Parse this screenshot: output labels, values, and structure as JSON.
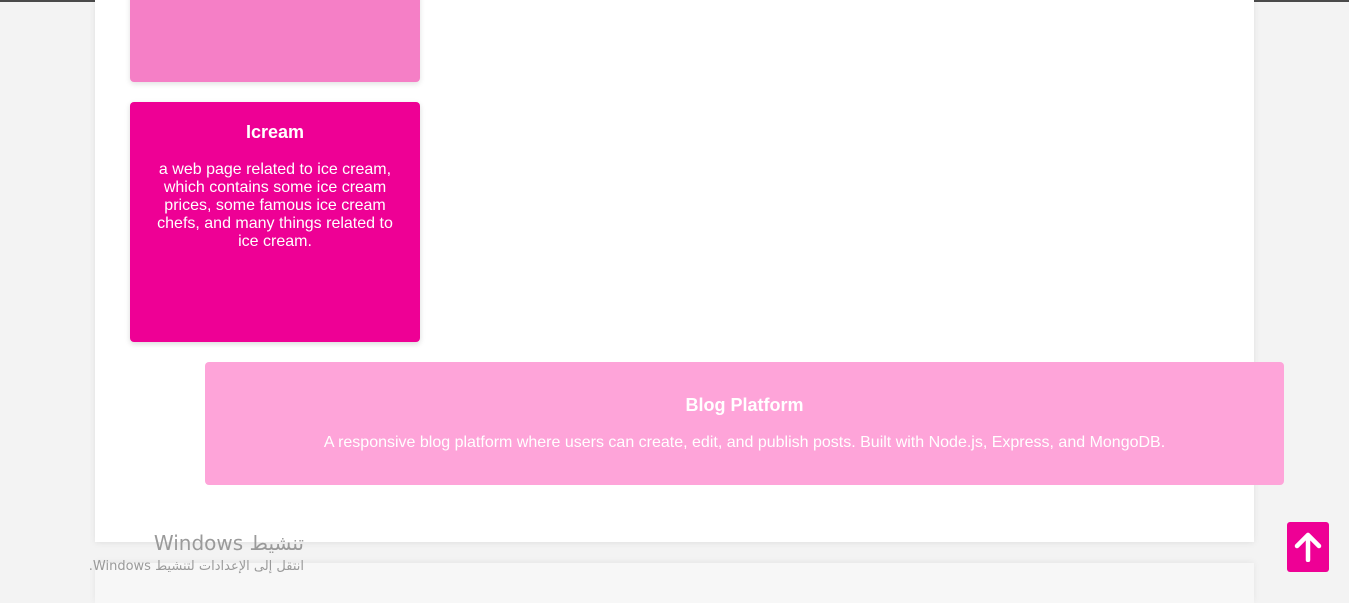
{
  "projects": [
    {
      "title": "",
      "description": "",
      "color": "#f57fc6"
    },
    {
      "title": "Icream",
      "description": "a web page related to ice cream, which contains some ice cream prices, some famous ice cream chefs, and many things related to ice cream.",
      "color": "#ee0095"
    },
    {
      "title": "Blog Platform",
      "description": "A responsive blog platform where users can create, edit, and publish posts. Built with Node.js, Express, and MongoDB.",
      "color": "#fea4d9"
    }
  ],
  "watermark": {
    "title": "تنشيط Windows",
    "subtitle": "انتقل إلى الإعدادات لتنشيط Windows."
  },
  "scroll_top": {
    "icon": "arrow-up-icon",
    "color": "#ee0095"
  },
  "colors": {
    "background": "#f3f3f3",
    "panel": "#ffffff",
    "accent": "#ee0095"
  }
}
